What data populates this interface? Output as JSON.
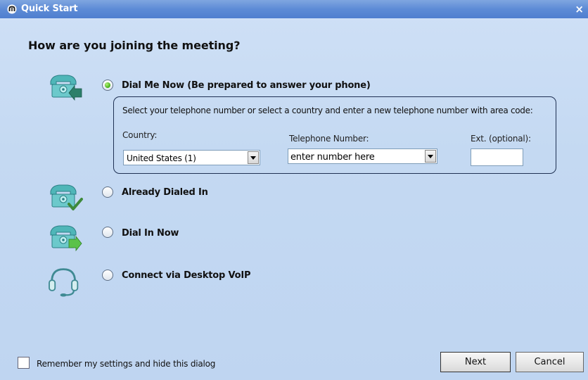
{
  "window": {
    "title": "Quick Start",
    "close_glyph": "×",
    "logo_icon": "app-logo-icon"
  },
  "heading": "How are you joining the meeting?",
  "options": [
    {
      "label": "Dial Me Now (Be prepared to answer your phone)",
      "selected": true,
      "icon": "phone-incoming-icon"
    },
    {
      "label": "Already Dialed In",
      "selected": false,
      "icon": "phone-check-icon"
    },
    {
      "label": "Dial In Now",
      "selected": false,
      "icon": "phone-outgoing-icon"
    },
    {
      "label": "Connect via Desktop VoIP",
      "selected": false,
      "icon": "headset-icon"
    }
  ],
  "dial_me_now": {
    "instructions": "Select your telephone number or select a country and enter a new telephone number with area code:",
    "country_label": "Country:",
    "country_value": "United States (1)",
    "phone_label": "Telephone Number:",
    "phone_value": "enter number here",
    "ext_label": "Ext. (optional):",
    "ext_value": ""
  },
  "footer": {
    "remember_label": "Remember my settings and hide this dialog",
    "remember_checked": false,
    "next_label": "Next",
    "cancel_label": "Cancel"
  },
  "colors": {
    "title_bar": "#5d8bd6",
    "background": "#c4d9f2",
    "radio_selected": "#3fae14"
  }
}
